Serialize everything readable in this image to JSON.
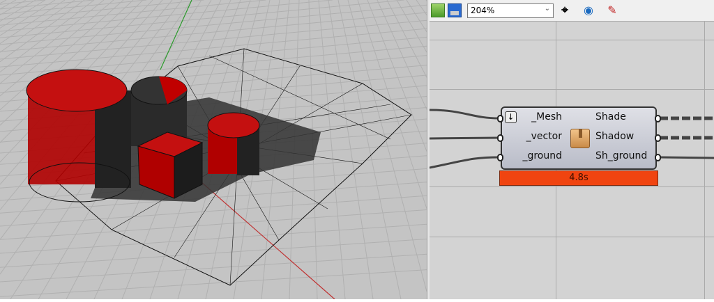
{
  "toolbar": {
    "zoom_value": "204%",
    "icons": [
      "open-folder-icon",
      "save-icon",
      "zoom-extents-icon",
      "preview-eye-icon",
      "sketch-pen-icon"
    ]
  },
  "component": {
    "inputs": [
      "_Mesh",
      "_vector",
      "_ground"
    ],
    "outputs": [
      "Shade",
      "Shadow",
      "Sh_ground"
    ],
    "runtime": "4.8s",
    "icon": "package-box-icon",
    "status_color": "#f04410"
  },
  "viewport": {
    "colors": {
      "solids": "#c00000",
      "shadow": "#333333",
      "x_axis": "#c03030",
      "y_axis": "#30a030"
    }
  }
}
